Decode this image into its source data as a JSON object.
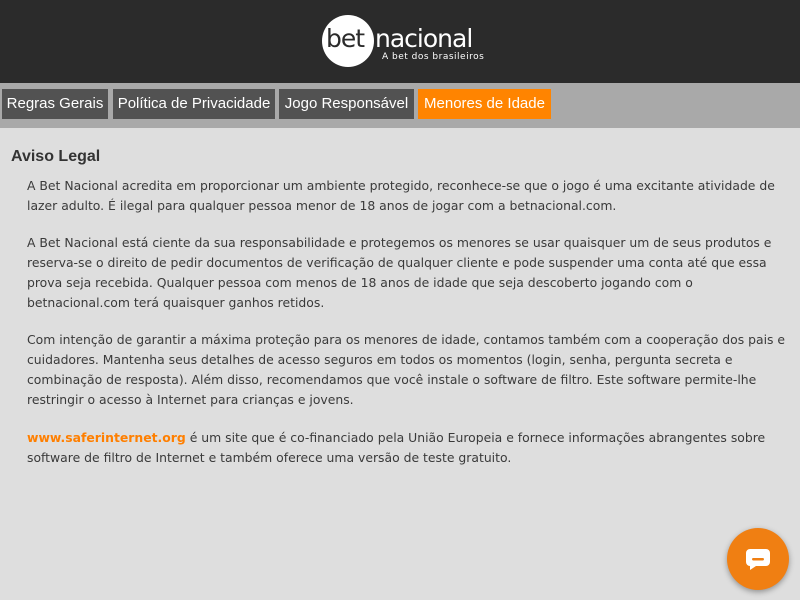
{
  "brand": {
    "logo_bet": "bet",
    "logo_nacional": "nacional",
    "tagline": "A bet dos brasileiros"
  },
  "tabs": [
    {
      "label": "Regras Gerais",
      "active": false
    },
    {
      "label": "Política de Privacidade",
      "active": false
    },
    {
      "label": "Jogo Responsável",
      "active": false
    },
    {
      "label": "Menores de Idade",
      "active": true
    }
  ],
  "content": {
    "title": "Aviso Legal",
    "paragraph_1": "A Bet Nacional acredita em proporcionar um ambiente protegido, reconhece-se que o jogo é uma excitante atividade de lazer adulto. É ilegal para qualquer pessoa menor de 18 anos de jogar com a betnacional.com.",
    "paragraph_2": "A Bet Nacional está ciente da sua responsabilidade e protegemos os menores se usar quaisquer um de seus produtos e reserva-se o direito de pedir documentos de verificação de qualquer cliente e pode suspender uma conta até que essa prova seja recebida. Qualquer pessoa com menos de 18 anos de idade que seja descoberto jogando com o betnacional.com terá quaisquer ganhos retidos.",
    "paragraph_3": "Com intenção de garantir a máxima proteção para os menores de idade, contamos também com a cooperação dos pais e cuidadores. Mantenha seus detalhes de acesso seguros em todos os momentos (login, senha, pergunta secreta e combinação de resposta). Além disso, recomendamos que você instale o software de filtro. Este software permite-lhe restringir o acesso à Internet para crianças e jovens.",
    "paragraph_4_link": "www.saferinternet.org",
    "paragraph_4_text": " é um site que é co-financiado pela União Europeia e fornece informações abrangentes sobre software de filtro de Internet e também oferece uma versão de teste gratuito."
  },
  "chat": {
    "icon": "chat-bubble-icon"
  },
  "colors": {
    "header_bg": "#2b2b2b",
    "tabbar_bg": "#a9a9a9",
    "tab_bg": "#525252",
    "tab_active_bg": "#ff8400",
    "content_bg": "#dedede",
    "link": "#ff7f00",
    "chat_button": "#f07f12"
  }
}
